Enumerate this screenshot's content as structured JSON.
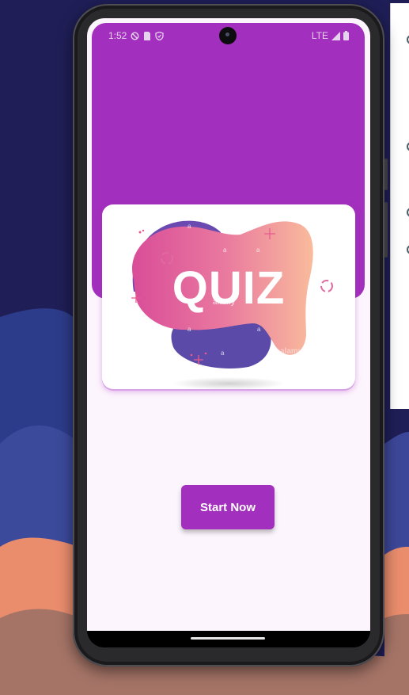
{
  "status_bar": {
    "time": "1:52",
    "network": "LTE"
  },
  "quiz_card": {
    "title": "QUIZ",
    "watermark": "alamy"
  },
  "start_button": {
    "label": "Start Now"
  },
  "colors": {
    "primary": "#a22fbd",
    "app_background": "#fdf5fd",
    "desktop_background": "#1f1e57",
    "quiz_pink": "#e0569b",
    "quiz_peach": "#f8b59a",
    "quiz_purple_blob": "#6a4ab0"
  }
}
